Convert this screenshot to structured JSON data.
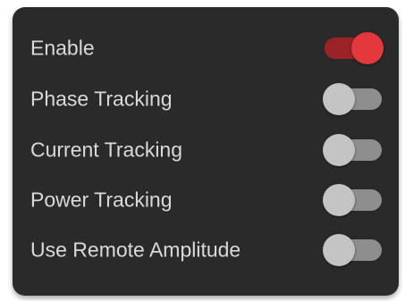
{
  "settings": {
    "items": [
      {
        "label": "Enable",
        "enabled": true
      },
      {
        "label": "Phase Tracking",
        "enabled": false
      },
      {
        "label": "Current Tracking",
        "enabled": false
      },
      {
        "label": "Power Tracking",
        "enabled": false
      },
      {
        "label": "Use Remote Amplitude",
        "enabled": false
      }
    ]
  },
  "colors": {
    "panel_bg": "#2b2a2b",
    "label_text": "#d9d9d9",
    "toggle_on_thumb": "#e5383c",
    "toggle_on_track": "#9a2327",
    "toggle_off_thumb": "#c4c4c4",
    "toggle_off_track": "#8e8e8e"
  }
}
